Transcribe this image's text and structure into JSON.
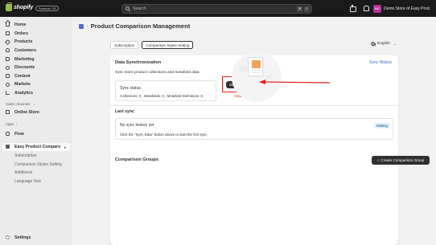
{
  "topbar": {
    "logo_text": "shopify",
    "edition_badge": "Summer '25",
    "search_placeholder": "Search",
    "shortcut_key1": "⌘",
    "shortcut_key2": "K",
    "avatar_initials": "DC",
    "store_name": "Demo Store of Easy Prod..."
  },
  "sidebar": {
    "items": [
      {
        "label": "Home",
        "icon": "home-icon"
      },
      {
        "label": "Orders",
        "icon": "orders-icon"
      },
      {
        "label": "Products",
        "icon": "products-icon"
      },
      {
        "label": "Customers",
        "icon": "customers-icon"
      },
      {
        "label": "Marketing",
        "icon": "marketing-icon"
      },
      {
        "label": "Discounts",
        "icon": "discounts-icon"
      },
      {
        "label": "Content",
        "icon": "content-icon"
      },
      {
        "label": "Markets",
        "icon": "markets-icon"
      },
      {
        "label": "Analytics",
        "icon": "analytics-icon"
      }
    ],
    "sales_channels_label": "Sales channels",
    "online_store_label": "Online Store",
    "apps_label": "Apps",
    "flow_label": "Flow",
    "app_label": "Easy Product Compare",
    "app_subitems": [
      "Subscription",
      "Comparison Styles Setting",
      "Additional",
      "Language Test"
    ],
    "settings_label": "Settings"
  },
  "main": {
    "page_title": "Product Comparison Management",
    "tabs": [
      {
        "label": "Subscription",
        "active": false
      },
      {
        "label": "Comparison Styles Setting",
        "active": true
      }
    ],
    "language": "English",
    "sync_card": {
      "title": "Data Synchronization",
      "history_link": "Sync History",
      "description": "Sync store product collections and metafield data",
      "status_label": "Sync status",
      "status_stats": "Collections: 0 ,   Metafields: 0 ,   Metafield Definitions: 0",
      "start_button": "Start Sync",
      "clear_button": "Clear",
      "last_sync_title": "Last sync",
      "no_history": "No sync history yet",
      "hint": "Click the \"Sync Data\" button above to start the first sync",
      "badge": "Waiting"
    },
    "groups_card": {
      "title": "Comparison Groups",
      "create_button": "Create Comparison Group"
    }
  },
  "colors": {
    "topbar_bg": "#1a1a1a",
    "accent_link": "#2c6ecb",
    "annotation_red": "#e02020",
    "badge_bg": "#e0f0ff"
  }
}
